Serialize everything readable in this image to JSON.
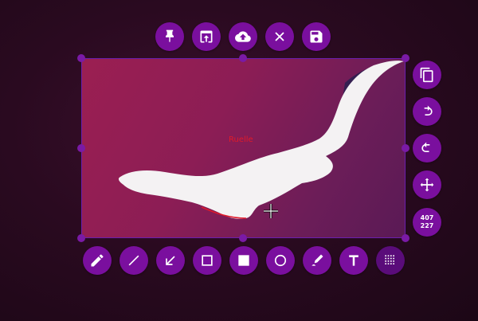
{
  "top_toolbar": {
    "buttons": [
      {
        "name": "pin",
        "icon": "pin-icon"
      },
      {
        "name": "upload-to-app",
        "icon": "open-in-app-icon"
      },
      {
        "name": "cloud-upload",
        "icon": "cloud-upload-icon"
      },
      {
        "name": "close",
        "icon": "close-icon"
      },
      {
        "name": "save",
        "icon": "save-icon"
      }
    ]
  },
  "right_toolbar": {
    "buttons": [
      {
        "name": "copy",
        "icon": "copy-icon"
      },
      {
        "name": "redo",
        "icon": "redo-icon"
      },
      {
        "name": "undo",
        "icon": "undo-icon"
      },
      {
        "name": "move",
        "icon": "move-icon"
      }
    ],
    "size_readout": {
      "width": "407",
      "height": "227"
    }
  },
  "bottom_toolbar": {
    "buttons": [
      {
        "name": "pencil",
        "icon": "pencil-icon"
      },
      {
        "name": "line",
        "icon": "line-icon"
      },
      {
        "name": "arrow",
        "icon": "arrow-icon"
      },
      {
        "name": "rectangle",
        "icon": "rectangle-outline-icon"
      },
      {
        "name": "filled-rectangle",
        "icon": "rectangle-filled-icon"
      },
      {
        "name": "circle",
        "icon": "circle-icon"
      },
      {
        "name": "marker",
        "icon": "marker-icon"
      },
      {
        "name": "text",
        "icon": "text-icon"
      },
      {
        "name": "pixelate",
        "icon": "pixelate-icon"
      }
    ]
  },
  "selection": {
    "label": "Ruelle"
  },
  "colors": {
    "accent": "#7a0f9e",
    "selection_text": "#e01a2a",
    "background": "#2a0a20"
  }
}
